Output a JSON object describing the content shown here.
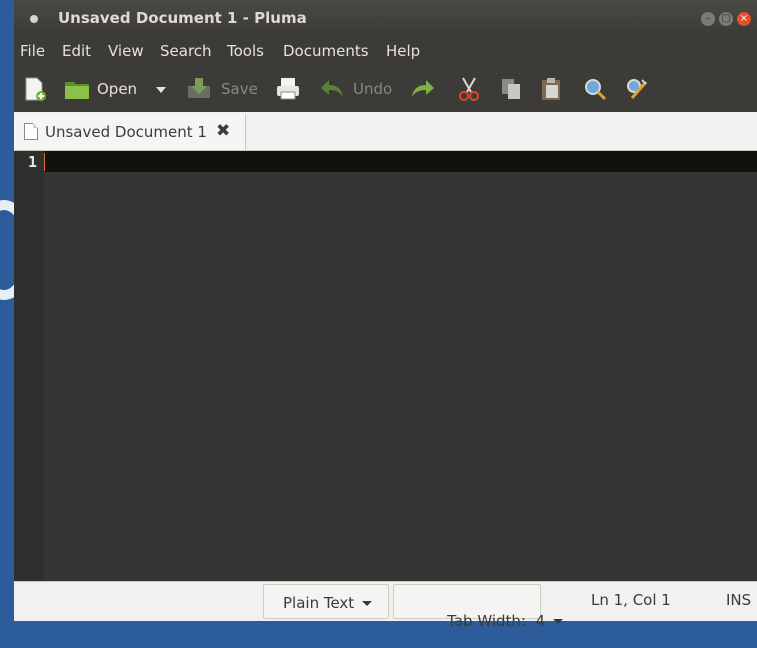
{
  "window": {
    "title": "Unsaved Document 1 - Pluma"
  },
  "menu": [
    "File",
    "Edit",
    "View",
    "Search",
    "Tools",
    "Documents",
    "Help"
  ],
  "toolbar": {
    "open_label": "Open",
    "save_label": "Save",
    "undo_label": "Undo"
  },
  "tab": {
    "label": "Unsaved Document 1"
  },
  "editor": {
    "line_number": "1"
  },
  "status": {
    "language": "Plain Text",
    "tab_width": "Tab Width:  4",
    "position": "Ln 1, Col 1",
    "mode": "INS"
  },
  "colors": {
    "editor_bg": "#353533",
    "current_line": "#0f130c",
    "caret": "#e36c2d"
  }
}
